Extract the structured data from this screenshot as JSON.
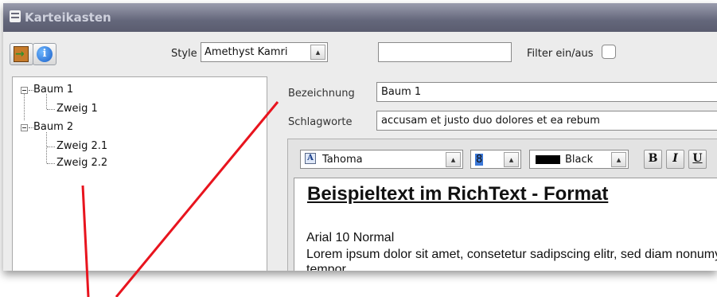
{
  "window": {
    "title": "Karteikasten"
  },
  "toolbar": {
    "style_label": "Style",
    "style_value": "Amethyst Kamri",
    "filter_value": "",
    "filter_label": "Filter ein/aus",
    "filter_checked": false
  },
  "tree": {
    "items": [
      {
        "label": "Baum 1",
        "level": 0,
        "expanded": true
      },
      {
        "label": "Zweig 1",
        "level": 1
      },
      {
        "label": "Baum 2",
        "level": 0,
        "expanded": true
      },
      {
        "label": "Zweig 2.1",
        "level": 1
      },
      {
        "label": "Zweig 2.2",
        "level": 1
      }
    ]
  },
  "details": {
    "bezeichnung_label": "Bezeichnung",
    "bezeichnung_value": "Baum 1",
    "schlagworte_label": "Schlagworte",
    "schlagworte_value": "accusam et justo duo dolores et ea rebum"
  },
  "editor": {
    "font": "Tahoma",
    "size": "8",
    "color_name": "Black",
    "color": "#000000",
    "bold_label": "B",
    "italic_label": "I",
    "underline_label": "U",
    "heading": "Beispieltext im RichText - Format",
    "style_line": "Arial 10 Normal",
    "body": "Lorem ipsum dolor sit amet, consetetur sadipscing elitr, sed diam nonumy eirmod tempor"
  },
  "colors": {
    "annotation": "#e8141e",
    "title_bar": "#64677b"
  }
}
